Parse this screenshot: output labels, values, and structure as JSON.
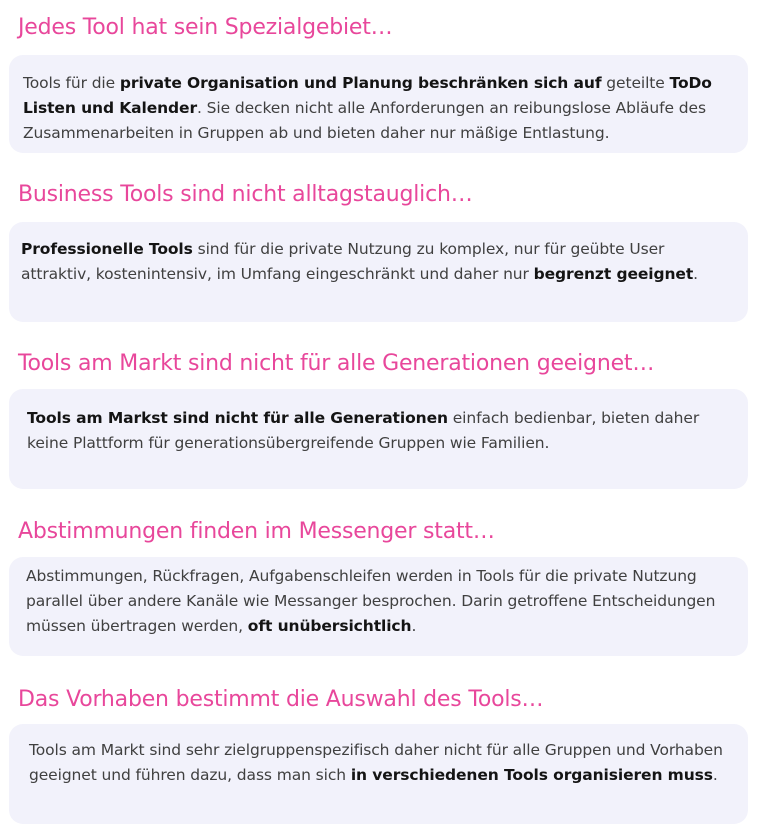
{
  "sections": [
    {
      "heading": "Jedes Tool hat sein Spezialgebiet…",
      "body": [
        {
          "t": "Tools für die "
        },
        {
          "t": "private Organisation und Planung beschränken sich auf",
          "b": true
        },
        {
          "t": " geteilte "
        },
        {
          "t": "ToDo Listen und Kalender",
          "b": true
        },
        {
          "t": ". Sie decken nicht alle Anforderungen an reibungslose Abläufe des Zusammenarbeiten in Gruppen ab und bieten daher nur mäßige Entlastung."
        }
      ]
    },
    {
      "heading": "Business Tools sind nicht alltagstauglich…",
      "body": [
        {
          "t": "Professionelle Tools",
          "b": true
        },
        {
          "t": " sind für die private Nutzung zu komplex, nur für geübte User attraktiv, kostenintensiv, im Umfang eingeschränkt und daher nur "
        },
        {
          "t": "begrenzt geeignet",
          "b": true
        },
        {
          "t": "."
        }
      ]
    },
    {
      "heading": "Tools am Markt sind nicht für alle Generationen geeignet…",
      "body": [
        {
          "t": "Tools am Markst sind nicht für alle Generationen",
          "b": true
        },
        {
          "t": " einfach bedienbar, bieten daher keine Plattform für generationsübergreifende Gruppen wie Familien."
        }
      ]
    },
    {
      "heading": "Abstimmungen finden im Messenger statt…",
      "body": [
        {
          "t": "Abstimmungen, Rückfragen, Aufgabenschleifen werden in Tools für die private Nutzung parallel über andere Kanäle wie Messanger besprochen. Darin getroffene Entscheidungen müssen übertragen werden, "
        },
        {
          "t": "oft unübersichtlich",
          "b": true
        },
        {
          "t": "."
        }
      ]
    },
    {
      "heading": "Das Vorhaben bestimmt die Auswahl des Tools…",
      "body": [
        {
          "t": "Tools am Markt sind sehr zielgruppenspezifisch daher nicht für alle Gruppen und Vorhaben geeignet und führen dazu, dass man sich "
        },
        {
          "t": "in verschiedenen Tools organisieren muss",
          "b": true
        },
        {
          "t": "."
        }
      ]
    }
  ]
}
